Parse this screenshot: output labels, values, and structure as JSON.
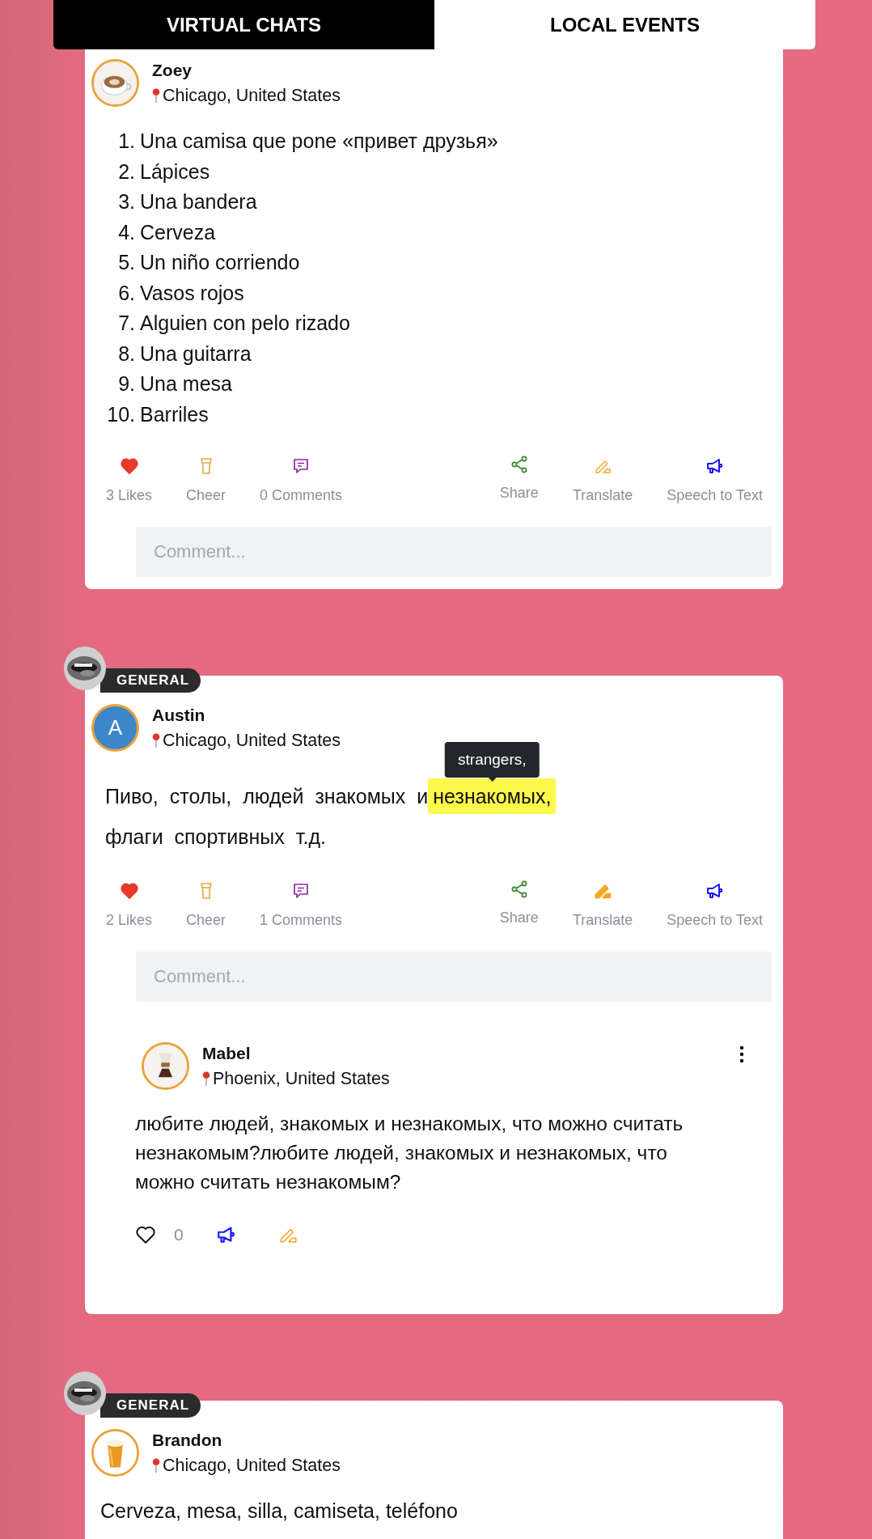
{
  "tabs": [
    {
      "label": "VIRTUAL CHATS",
      "selected": true
    },
    {
      "label": "LOCAL EVENTS",
      "selected": false
    }
  ],
  "posts": [
    {
      "author": {
        "name": "Zoey",
        "location": "Chicago, United States"
      },
      "body": {
        "kind": "list",
        "items": [
          {
            "number": "1.",
            "text": "Una camisa que pone «привет друзья»"
          },
          {
            "number": "2.",
            "text": "Lápices"
          },
          {
            "number": "3.",
            "text": "Una bandera"
          },
          {
            "number": "4.",
            "text": "Cerveza"
          },
          {
            "number": "5.",
            "text": "Un niño corriendo"
          },
          {
            "number": "6.",
            "text": "Vasos rojos"
          },
          {
            "number": "7.",
            "text": "Alguien con pelo rizado"
          },
          {
            "number": "8.",
            "text": "Una guitarra"
          },
          {
            "number": "9.",
            "text": "Una mesa"
          },
          {
            "number": "10.",
            "text": "Barriles"
          }
        ]
      },
      "actions": {
        "likes": "3 Likes",
        "liked": true,
        "cheer": "Cheer",
        "comments": "0 Comments",
        "share": "Share",
        "translate": "Translate",
        "translate_active": false,
        "speech": "Speech to Text"
      },
      "comment_field": {
        "placeholder": "Comment..."
      }
    },
    {
      "badge": "GENERAL",
      "author": {
        "name": "Austin",
        "location": "Chicago, United States",
        "avatar": {
          "kind": "initial",
          "initial": "A"
        }
      },
      "body": {
        "kind": "paragraph",
        "lines": [
          [
            {
              "text": "Пиво, столы, людей знакомых и",
              "highlighted": false
            },
            {
              "text": "незнакомых,",
              "highlighted": true,
              "tooltip": "strangers,"
            }
          ],
          [
            {
              "text": "флаги спортивных т.д.",
              "highlighted": false
            }
          ]
        ]
      },
      "actions": {
        "likes": "2 Likes",
        "liked": true,
        "cheer": "Cheer",
        "comments": "1 Comments",
        "share": "Share",
        "translate": "Translate",
        "translate_active": true,
        "speech": "Speech to Text"
      },
      "comment_field": {
        "placeholder": "Comment..."
      },
      "replies": [
        {
          "author": {
            "name": "Mabel",
            "location": "Phoenix, United States"
          },
          "text": "любите людей, знакомых и незнакомых, что можно считать незнакомым?любите людей, знакомых и незнакомых, что можно считать незнакомым?",
          "liked": false,
          "likes": "0"
        }
      ]
    },
    {
      "badge": "GENERAL",
      "author": {
        "name": "Brandon",
        "location": "Chicago, United States"
      },
      "body": {
        "kind": "paragraph",
        "lines": [
          [
            {
              "text": "Cerveza, mesa, silla, camiseta, teléfono",
              "highlighted": false
            }
          ]
        ]
      }
    }
  ]
}
